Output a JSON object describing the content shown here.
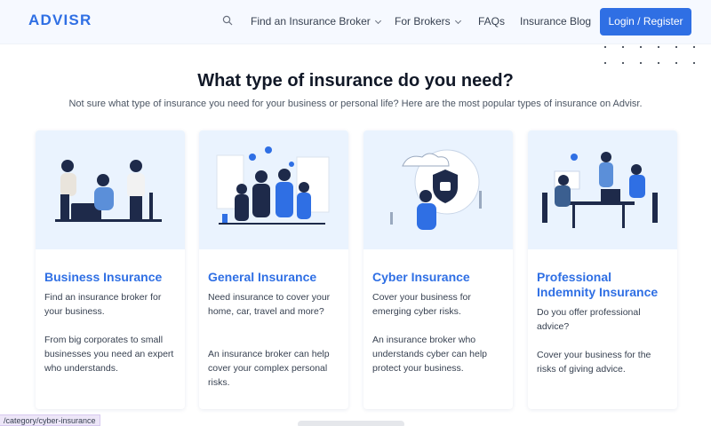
{
  "header": {
    "logo": "ADVISR",
    "nav": [
      {
        "label": "Find an Insurance Broker"
      },
      {
        "label": "For Brokers"
      },
      {
        "label": "FAQs"
      },
      {
        "label": "Insurance Blog"
      }
    ],
    "login_label": "Login / Register"
  },
  "section": {
    "title": "What type of insurance do you need?",
    "subtitle": "Not sure what type of insurance you need for your business or personal life? Here are the most popular types of insurance on Advisr."
  },
  "cards": [
    {
      "title": "Business Insurance",
      "p1": "Find an insurance broker for your business.",
      "p2": "From big corporates to small businesses you need an expert who understands."
    },
    {
      "title": "General Insurance",
      "p1": "Need insurance to cover your home, car, travel and more?",
      "p2": "An insurance broker can help cover your complex personal risks."
    },
    {
      "title": "Cyber Insurance",
      "p1": "Cover your business for emerging cyber risks.",
      "p2": "An insurance broker who understands cyber can help protect your business."
    },
    {
      "title": "Professional Indemnity Insurance",
      "p1": "Do you offer professional advice?",
      "p2": "Cover your business for the risks of giving advice."
    }
  ],
  "status_url": "/category/cyber-insurance",
  "colors": {
    "accent": "#2f6fe4",
    "card_bg": "#eaf3fe",
    "illustration_dark": "#1e2a4a"
  },
  "icons": [
    "search-icon",
    "chevron-down-icon"
  ]
}
